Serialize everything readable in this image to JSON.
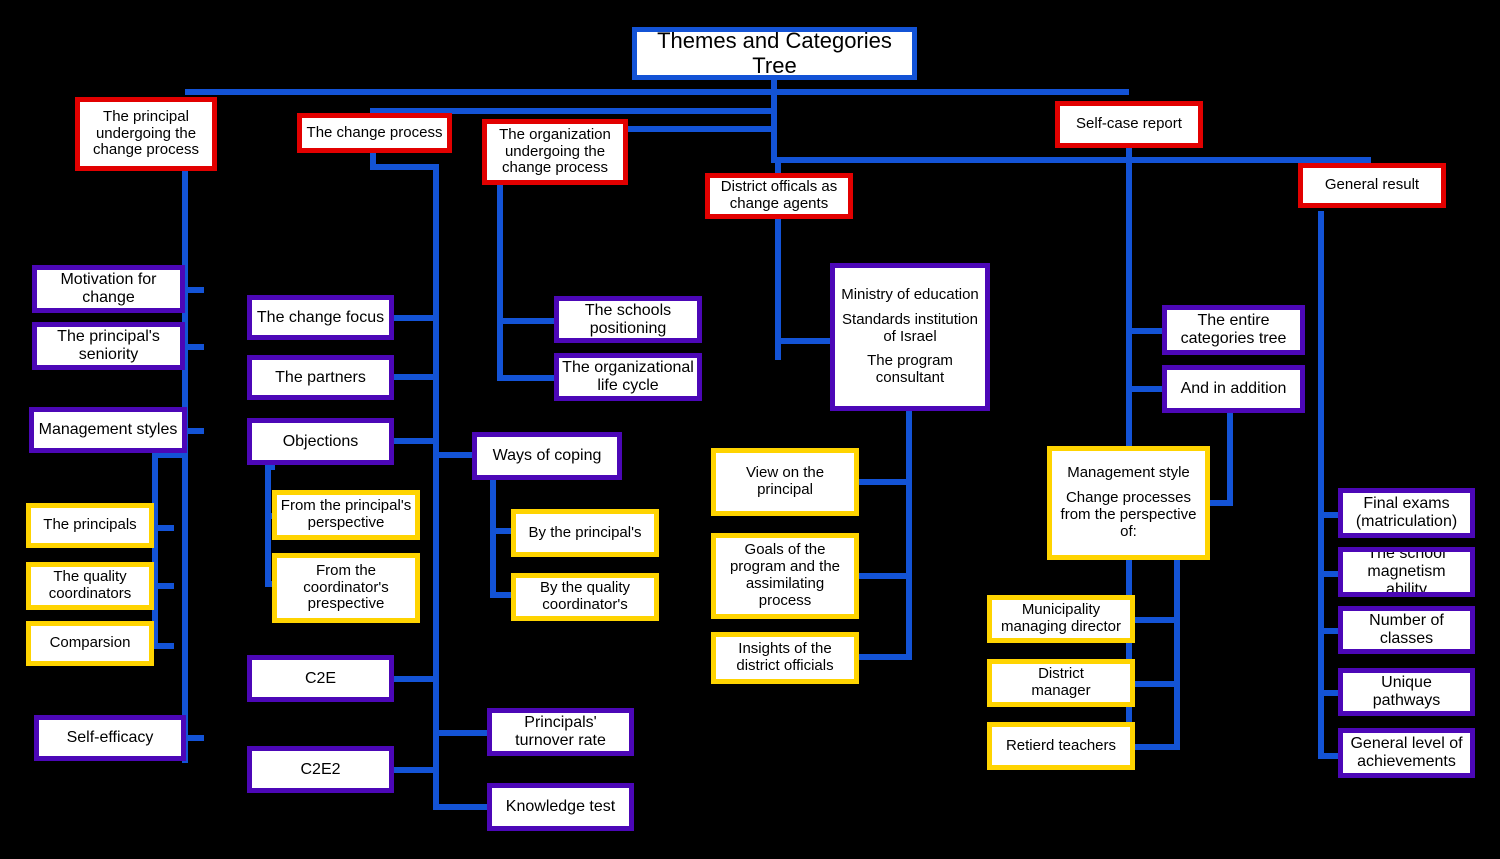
{
  "diagram": {
    "title": "Themes and Categories Tree",
    "background": "#000000",
    "colors": {
      "root_border": "#1353d6",
      "theme_border": "#e20000",
      "category_border": "#4c07b7",
      "subcategory_border": "#ffd400",
      "connector": "#1353d6",
      "node_fill": "#ffffff",
      "text": "#000000"
    }
  },
  "nodes": {
    "root": "Themes and Categories Tree",
    "theme_principal": "The principal undergoing the change process",
    "theme_change_process": "The change process",
    "theme_organization": "The organization undergoing the change process",
    "theme_district_officials": "District officals as change agents",
    "theme_self_case_report": "Self-case report",
    "theme_general_result": "General result",
    "motivation_for_change": "Motivation for change",
    "principals_seniority": "The principal's seniority",
    "management_styles": "Management styles",
    "the_principals": "The principals",
    "quality_coordinators": "The quality coordinators",
    "comparsion": "Comparsion",
    "self_efficacy": "Self-efficacy",
    "change_focus": "The change focus",
    "the_partners": "The partners",
    "objections": "Objections",
    "from_principals_perspective": "From the principal's perspective",
    "from_coordinators_prespective": "From the coordinator's prespective",
    "c2e": "C2E",
    "c2e2": "C2E2",
    "ways_of_coping": "Ways of coping",
    "by_the_principals": "By the principal's",
    "by_the_quality_coordinators": "By the quality coordinator's",
    "principals_turnover_rate": "Principals'  turnover rate",
    "knowledge_test": "Knowledge test",
    "schools_positioning": "The schools positioning",
    "organizational_life_cycle": "The organizational life cycle",
    "ministry_line1": "Ministry of education",
    "ministry_line2": "Standards institution of Israel",
    "ministry_line3": "The program consultant",
    "view_on_the_principal": "View on the principal",
    "goals_of_the_program": "Goals of the program and the assimilating process",
    "insights_of_district_officials": "Insights of the district officials",
    "entire_categories_tree": "The entire categories tree",
    "and_in_addition": "And in addition",
    "management_style_line1": "Management style",
    "management_style_line2": "Change processes from the perspective of:",
    "municipality_managing_director": "Municipality managing director",
    "district_manager_line1": "District",
    "district_manager_line2": "manager",
    "retierd_teachers": "Retierd teachers",
    "final_exams": "Final exams (matriculation)",
    "school_magnetism_ability": "The school magnetism ability",
    "number_of_classes": "Number of classes",
    "unique_pathways": "Unique pathways",
    "general_level_of_achievements": "General level of achievements"
  }
}
